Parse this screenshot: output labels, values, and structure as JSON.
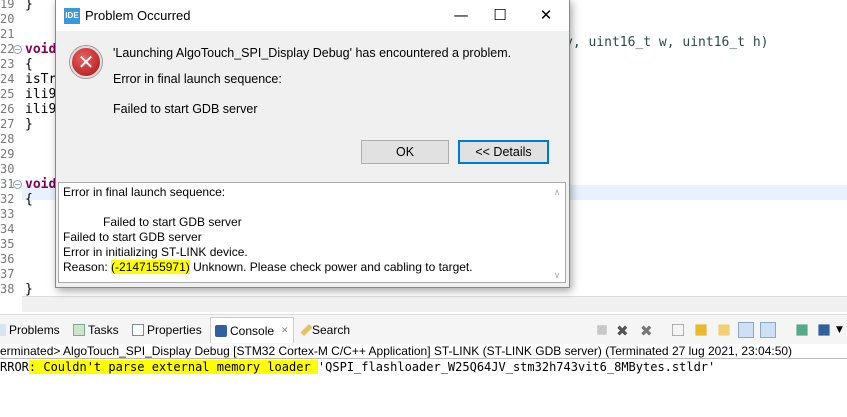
{
  "editor": {
    "line_numbers": [
      "19",
      "20",
      "21",
      "22",
      "23",
      "24",
      "25",
      "26",
      "27",
      "28",
      "29",
      "30",
      "31",
      "32",
      "33",
      "34",
      "35",
      "36",
      "37",
      "38"
    ],
    "lines": {
      "19": "}",
      "22": "void",
      "23": "{",
      "24": "isTr",
      "25": "ili9",
      "26": "ili9",
      "27": "}",
      "31": "void",
      "32": "{",
      "38": "}"
    },
    "line22_tail": "y, uint16_t w, uint16_t h)"
  },
  "dialog": {
    "title": "Problem Occurred",
    "app_badge": "IDE",
    "message": "'Launching AlgoTouch_SPI_Display Debug' has encountered a problem.",
    "sub1": "Error in final launch sequence:",
    "sub2": "Failed to start GDB server",
    "ok_label": "OK",
    "details_label": "<< Details",
    "details_lines": [
      "Error in final launch sequence:",
      "",
      "            Failed to start GDB server",
      "Failed to start GDB server",
      "Error in initializing ST-LINK device."
    ],
    "reason_prefix": "Reason: ",
    "reason_code": "(-2147155971)",
    "reason_text": " Unknown. Please check power and cabling to target."
  },
  "tabs": [
    {
      "label": "Problems"
    },
    {
      "label": "Tasks"
    },
    {
      "label": "Properties"
    },
    {
      "label": "Console",
      "close": "✕"
    },
    {
      "label": "Search"
    }
  ],
  "console": {
    "header": "erminated> AlgoTouch_SPI_Display Debug [STM32 Cortex-M C/C++ Application] ST-LINK (ST-LINK GDB server) (Terminated 27 lug 2021, 23:04:50)",
    "out_prefix": "RROR",
    "out_highlight": ": Couldn't parse external memory loader ",
    "out_rest": "'QSPI_flashloader_W25Q64JV_stm32h743vit6_8MBytes.stldr'"
  }
}
